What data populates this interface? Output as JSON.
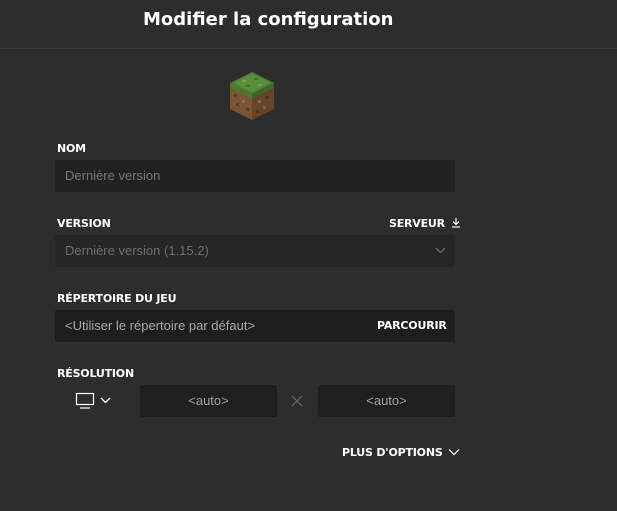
{
  "header": {
    "title": "Modifier la configuration"
  },
  "profile_icon": "grass-block-icon",
  "name_field": {
    "label": "NOM",
    "placeholder": "Dernière version"
  },
  "version_field": {
    "label": "VERSION",
    "server_label": "SERVEUR",
    "value": "Dernière version (1.15.2)"
  },
  "game_dir": {
    "label": "RÉPERTOIRE DU JEU",
    "placeholder": "<Utiliser le répertoire par défaut>",
    "browse_label": "PARCOURIR"
  },
  "resolution": {
    "label": "RÉSOLUTION",
    "width_value": "<auto>",
    "height_value": "<auto>"
  },
  "more_options": {
    "label": "PLUS D'OPTIONS"
  },
  "colors": {
    "background": "#2d2d2d",
    "field": "#212121",
    "text": "#ffffff",
    "muted": "#777777"
  }
}
